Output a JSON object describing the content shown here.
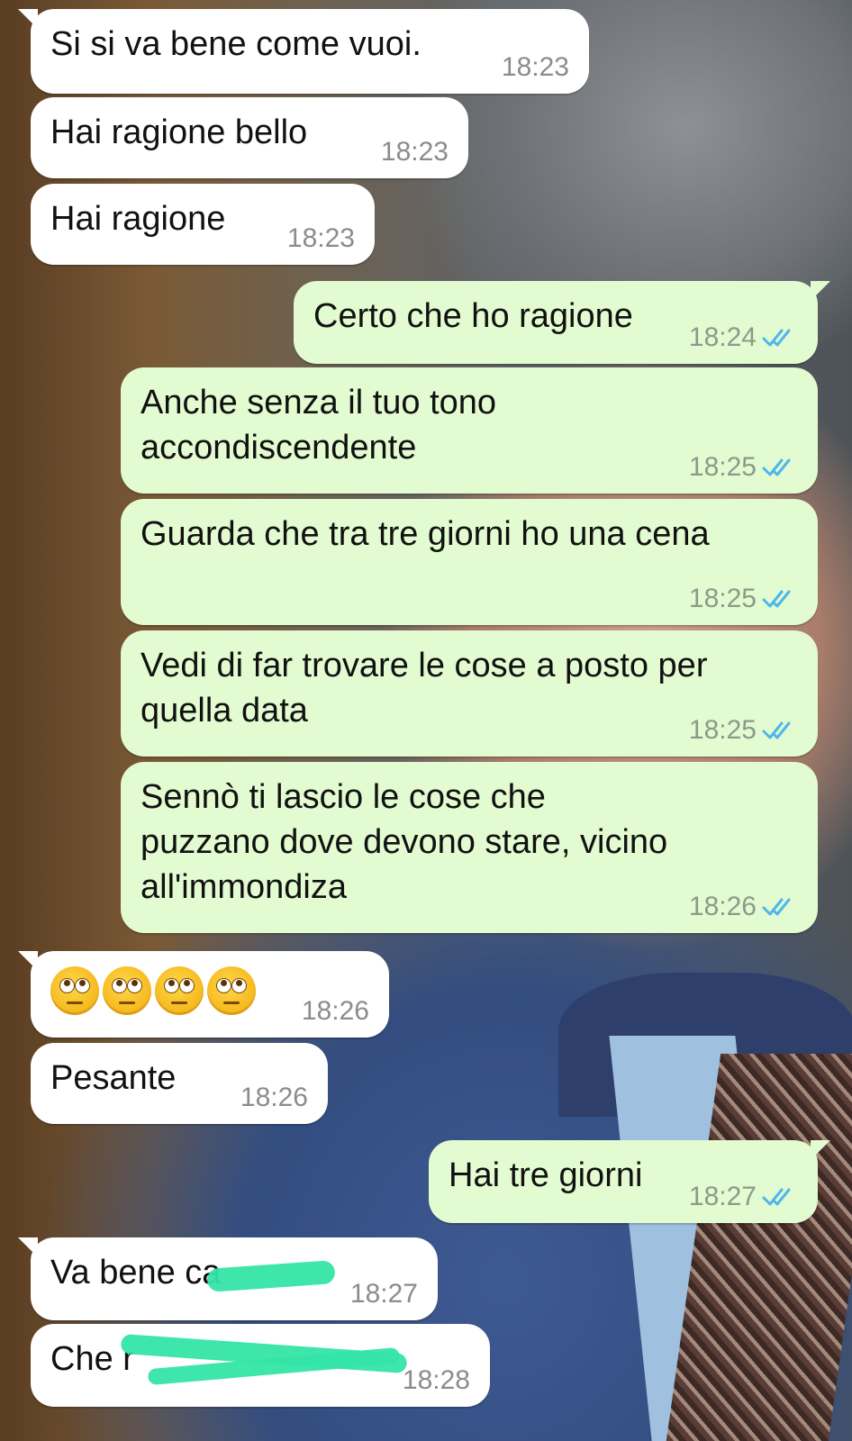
{
  "messages": [
    {
      "direction": "incoming",
      "text": "Si si va bene come vuoi.",
      "time": "18:23"
    },
    {
      "direction": "incoming",
      "text": "Hai ragione bello",
      "time": "18:23"
    },
    {
      "direction": "incoming",
      "text": "Hai ragione",
      "time": "18:23"
    },
    {
      "direction": "outgoing",
      "text": "Certo che ho ragione",
      "time": "18:24",
      "status": "read"
    },
    {
      "direction": "outgoing",
      "text": "Anche senza il tuo tono\naccondiscendente",
      "time": "18:25",
      "status": "read"
    },
    {
      "direction": "outgoing",
      "text": "Guarda che tra tre giorni ho una cena",
      "time": "18:25",
      "status": "read"
    },
    {
      "direction": "outgoing",
      "text": "Vedi di far trovare le cose a posto per\nquella data",
      "time": "18:25",
      "status": "read"
    },
    {
      "direction": "outgoing",
      "text": "Sennò ti lascio le cose che\npuzzano dove devono stare, vicino\nall'immondiza",
      "time": "18:26",
      "status": "read"
    },
    {
      "direction": "incoming",
      "emoji": [
        "face-with-rolling-eyes",
        "face-with-rolling-eyes",
        "face-with-rolling-eyes",
        "face-with-rolling-eyes"
      ],
      "time": "18:26"
    },
    {
      "direction": "incoming",
      "text": "Pesante",
      "time": "18:26"
    },
    {
      "direction": "outgoing",
      "text": "Hai tre giorni",
      "time": "18:27",
      "status": "read"
    },
    {
      "direction": "incoming",
      "text": "Va bene ca",
      "time": "18:27",
      "redacted": true
    },
    {
      "direction": "incoming",
      "text": "Che r",
      "time": "18:28",
      "redacted": true
    }
  ],
  "colors": {
    "incoming_bubble": "#ffffff",
    "outgoing_bubble": "#e2fbd0",
    "read_ticks": "#4fb6ec",
    "redaction": "#35e5a6"
  }
}
